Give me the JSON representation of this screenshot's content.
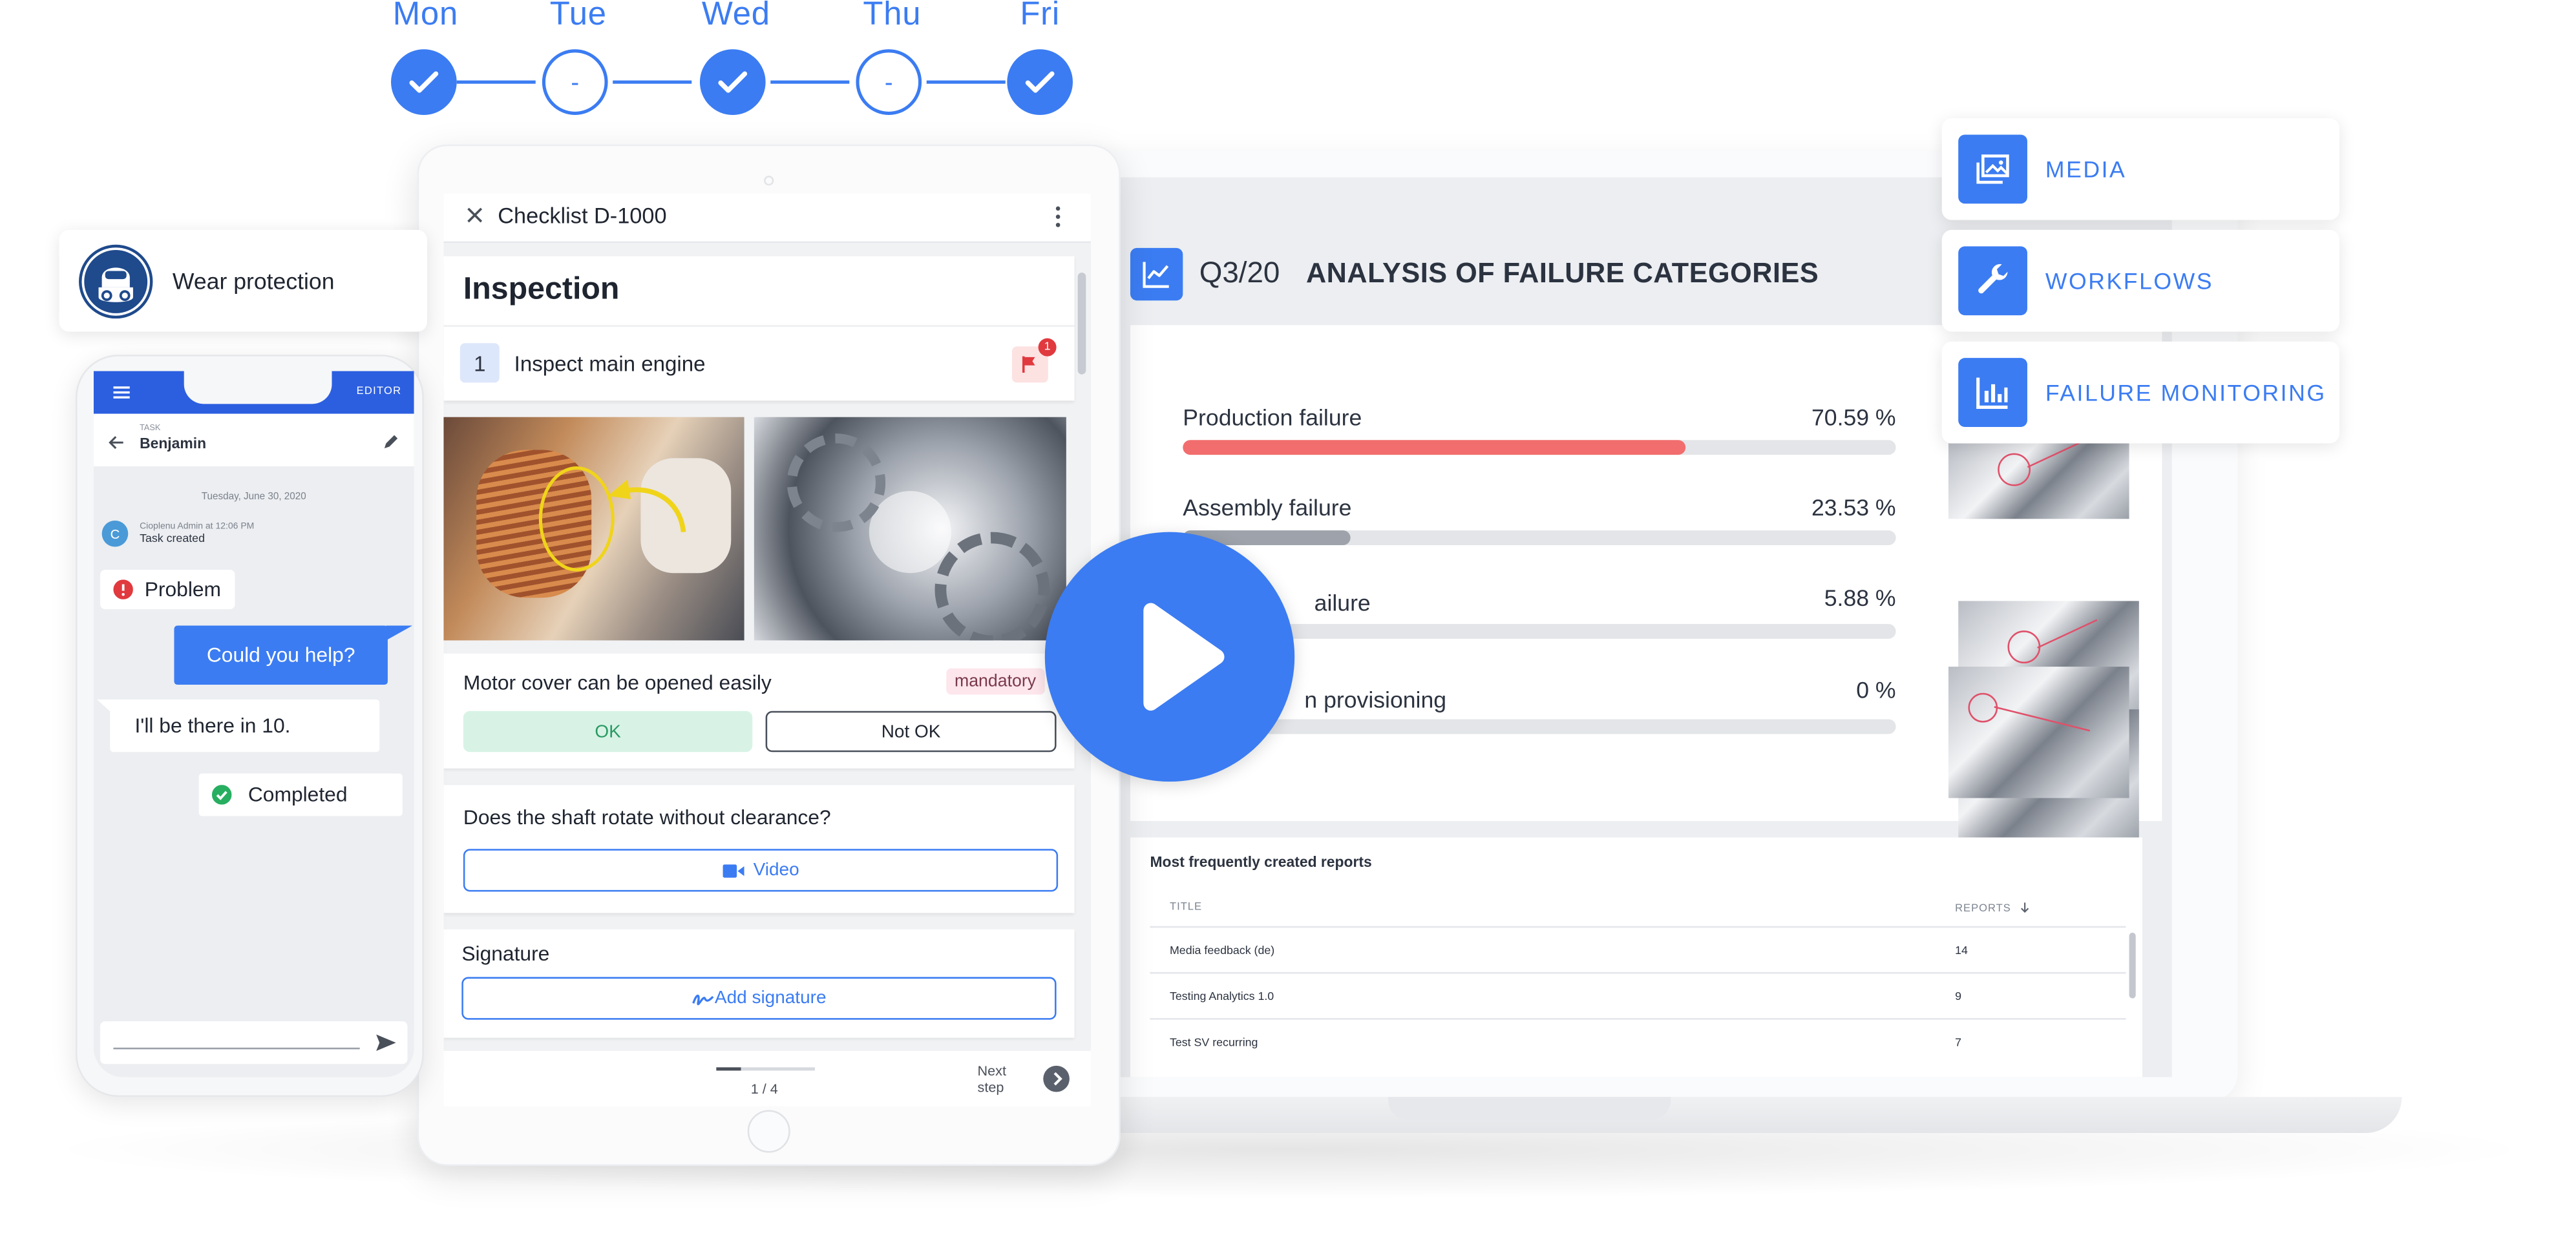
{
  "week": {
    "days": [
      {
        "label": "Mon",
        "status": "done"
      },
      {
        "label": "Tue",
        "status": "pending",
        "mark": "-"
      },
      {
        "label": "Wed",
        "status": "done"
      },
      {
        "label": "Thu",
        "status": "pending",
        "mark": "-"
      },
      {
        "label": "Fri",
        "status": "done"
      }
    ]
  },
  "colors": {
    "accent": "#3b7cf2",
    "failure_red": "#f26d6d",
    "bar_gray": "#9ea3ab",
    "ok_green": "#d8f3e6"
  },
  "analytics": {
    "period": "Q3/20",
    "title": "ANALYSIS OF FAILURE CATEGORIES",
    "icon": "line-chart-icon",
    "bars": [
      {
        "label": "Production failure",
        "percent_text": "70.59 %",
        "value": 70.59
      },
      {
        "label": "Assembly failure",
        "percent_text": "23.53 %",
        "value": 23.53
      },
      {
        "label": "ailure",
        "percent_text": "5.88 %",
        "value": 5.88
      },
      {
        "label": "n provisioning",
        "percent_text": "0 %",
        "value": 0
      }
    ],
    "reports": {
      "title": "Most frequently created reports",
      "col_title": "TITLE",
      "col_reports": "REPORTS",
      "rows": [
        {
          "title": "Media feedback (de)",
          "count": "14"
        },
        {
          "title": "Testing Analytics 1.0",
          "count": "9"
        },
        {
          "title": "Test SV recurring",
          "count": "7"
        }
      ]
    }
  },
  "nav_cards": [
    {
      "label": "MEDIA",
      "icon": "media-gallery-icon"
    },
    {
      "label": "WORKFLOWS",
      "icon": "wrench-icon"
    },
    {
      "label": "FAILURE MONITORING",
      "icon": "bar-chart-icon"
    }
  ],
  "checklist": {
    "title": "Checklist D-1000",
    "section": "Inspection",
    "step_number": "1",
    "step_label": "Inspect main engine",
    "flag_count": "1",
    "question1": "Motor cover can be opened easily",
    "mandatory": "mandatory",
    "ok": "OK",
    "not_ok": "Not OK",
    "question2": "Does the shaft rotate without clearance?",
    "video": "Video",
    "signature_title": "Signature",
    "add_signature": "Add signature",
    "pager": "1 / 4",
    "next_step": "Next\nstep",
    "progress": 0.25
  },
  "phone": {
    "editor": "EDITOR",
    "task_kicker": "TASK",
    "task_name": "Benjamin",
    "date": "Tuesday, June 30, 2020",
    "avatar_initial": "C",
    "log_author": "Cioplenu Admin at 12:06 PM",
    "log_text": "Task created",
    "problem": "Problem",
    "msg_out": "Could you help?",
    "msg_in": "I'll be there in 10.",
    "completed": "Completed"
  },
  "wear": {
    "label": "Wear protection"
  }
}
